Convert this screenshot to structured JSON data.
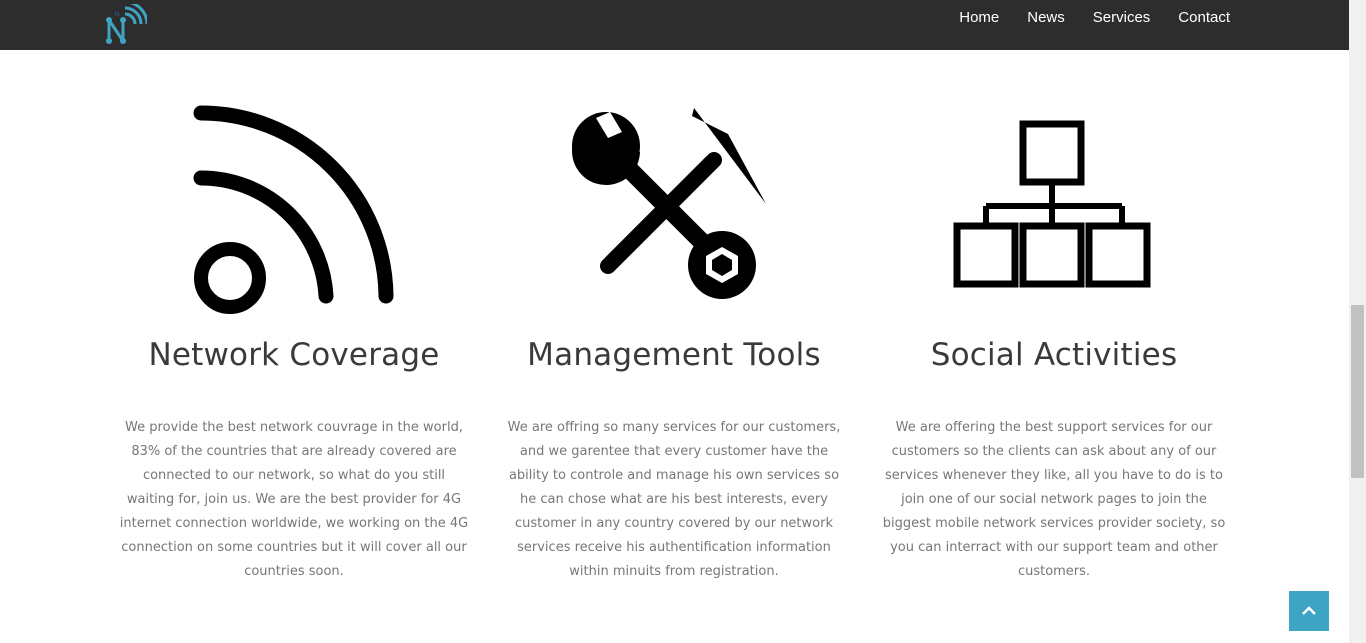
{
  "navbar": {
    "logo_alt": "N",
    "links": [
      "Home",
      "News",
      "Services",
      "Contact"
    ],
    "background": "#2d2d2d"
  },
  "features": [
    {
      "icon": "wifi-signal-icon",
      "title": "Network Coverage",
      "text": "We provide the best network couvrage in the world, 83% of the countries that are already covered are connected to our network, so what do you still waiting for, join us. We are the best provider for 4G internet connection worldwide, we working on the 4G connection on some countries but it will cover all our countries soon."
    },
    {
      "icon": "tools-icon",
      "title": "Management Tools",
      "text": "We are offring so many services for our customers, and we garentee that every customer have the ability to controle and manage his own services so he can chose what are his best interests, every customer in any country covered by our network services receive his authentification information within minuits from registration."
    },
    {
      "icon": "network-hierarchy-icon",
      "title": "Social Activities",
      "text": "We are offering the best support services for our customers so the clients can ask about any of our services whenever they like, all you have to do is to join one of our social network pages to join the biggest mobile network services provider society, so you can interract with our support team and other customers."
    }
  ],
  "back_to_top": {
    "icon": "chevron-up-icon",
    "color": "#3ea4c4"
  }
}
